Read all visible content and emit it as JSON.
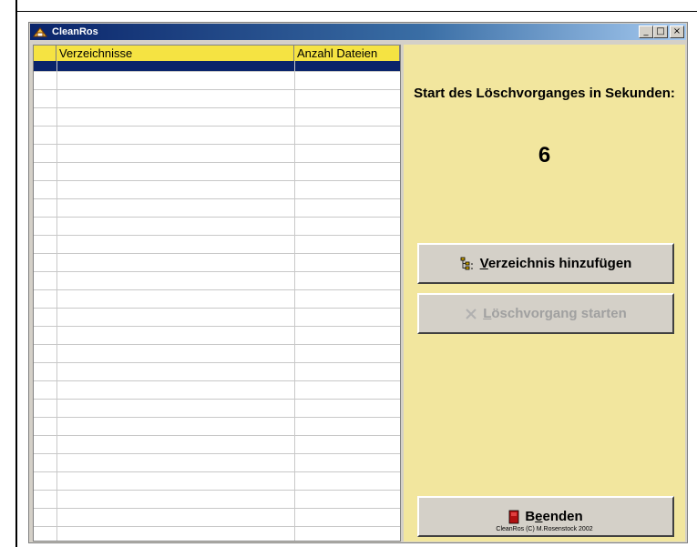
{
  "window": {
    "title": "CleanRos",
    "controls": {
      "minimize": "_",
      "maximize": "□",
      "close": "×"
    }
  },
  "grid": {
    "columns": [
      "Verzeichnisse",
      "Anzahl Dateien"
    ],
    "rows": []
  },
  "panel": {
    "countdown_label": "Start des Löschvorganges in Sekunden:",
    "countdown_value": "6",
    "buttons": {
      "add_directory": {
        "mnemonic": "V",
        "rest": "erzeichnis hinzufügen"
      },
      "start_delete": {
        "mnemonic": "L",
        "rest": "öschvorgang starten"
      },
      "exit": {
        "pre": "B",
        "mnemonic": "e",
        "rest": "enden"
      }
    },
    "copyright": "CleanRos (C) M.Rosenstock 2002"
  },
  "colors": {
    "panel": "#f2e69e",
    "grid_header": "#f5e342",
    "selection": "#0a246a",
    "titlebar": "#0a246a"
  },
  "icons": {
    "app": "app-icon",
    "add": "folder-tree-icon",
    "delete": "delete-x-icon",
    "exit": "door-icon"
  }
}
